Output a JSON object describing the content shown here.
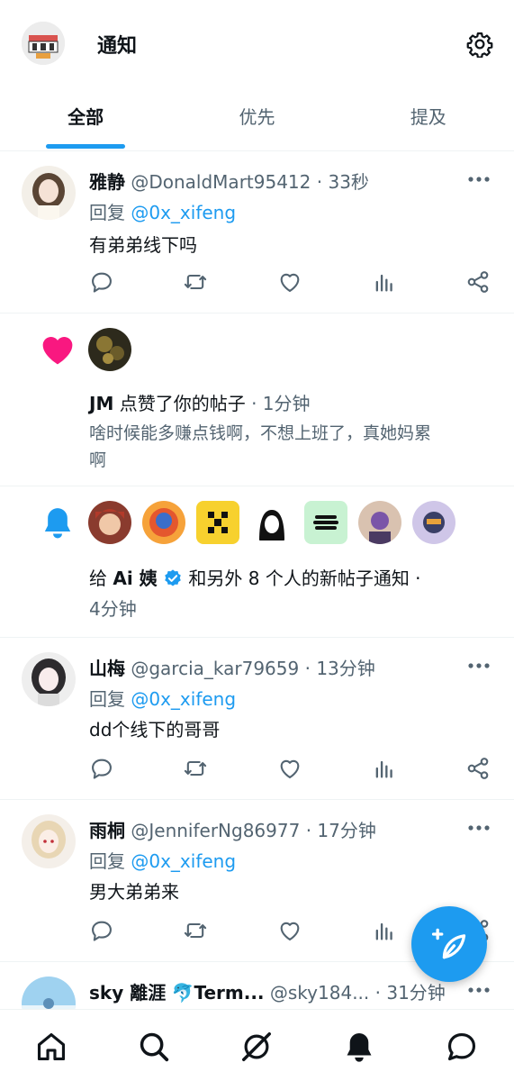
{
  "header": {
    "title": "通知"
  },
  "tabs": [
    {
      "label": "全部",
      "active": true
    },
    {
      "label": "优先",
      "active": false
    },
    {
      "label": "提及",
      "active": false
    }
  ],
  "replies": [
    {
      "name": "雅静",
      "handle": "@DonaldMart95412",
      "time": "33秒",
      "reply_prefix": "回复",
      "reply_to": "@0x_xifeng",
      "text": "有弟弟线下吗"
    },
    {
      "name": "山梅",
      "handle": "@garcia_kar79659",
      "time": "13分钟",
      "reply_prefix": "回复",
      "reply_to": "@0x_xifeng",
      "text": "dd个线下的哥哥"
    },
    {
      "name": "雨桐",
      "handle": "@JenniferNg86977",
      "time": "17分钟",
      "reply_prefix": "回复",
      "reply_to": "@0x_xifeng",
      "text": "男大弟弟来"
    }
  ],
  "like_notification": {
    "name": "JM",
    "action": "点赞了你的帖子",
    "time": "1分钟",
    "text_line1": "啥时候能多赚点钱啊，不想上班了，真她妈累",
    "text_line2": "啊"
  },
  "bell_notification": {
    "prefix": "给",
    "name": "Ai 姨",
    "suffix": "和另外 8 个人的新帖子通知 ·",
    "time": "4分钟"
  },
  "partial_item": {
    "name": "sky 離涯",
    "name2": "Term...",
    "handle": "@sky184...",
    "time": "· 31分钟"
  },
  "colors": {
    "accent": "#1d9bf0",
    "like": "#f91880",
    "muted": "#536471",
    "text": "#0f1419"
  }
}
